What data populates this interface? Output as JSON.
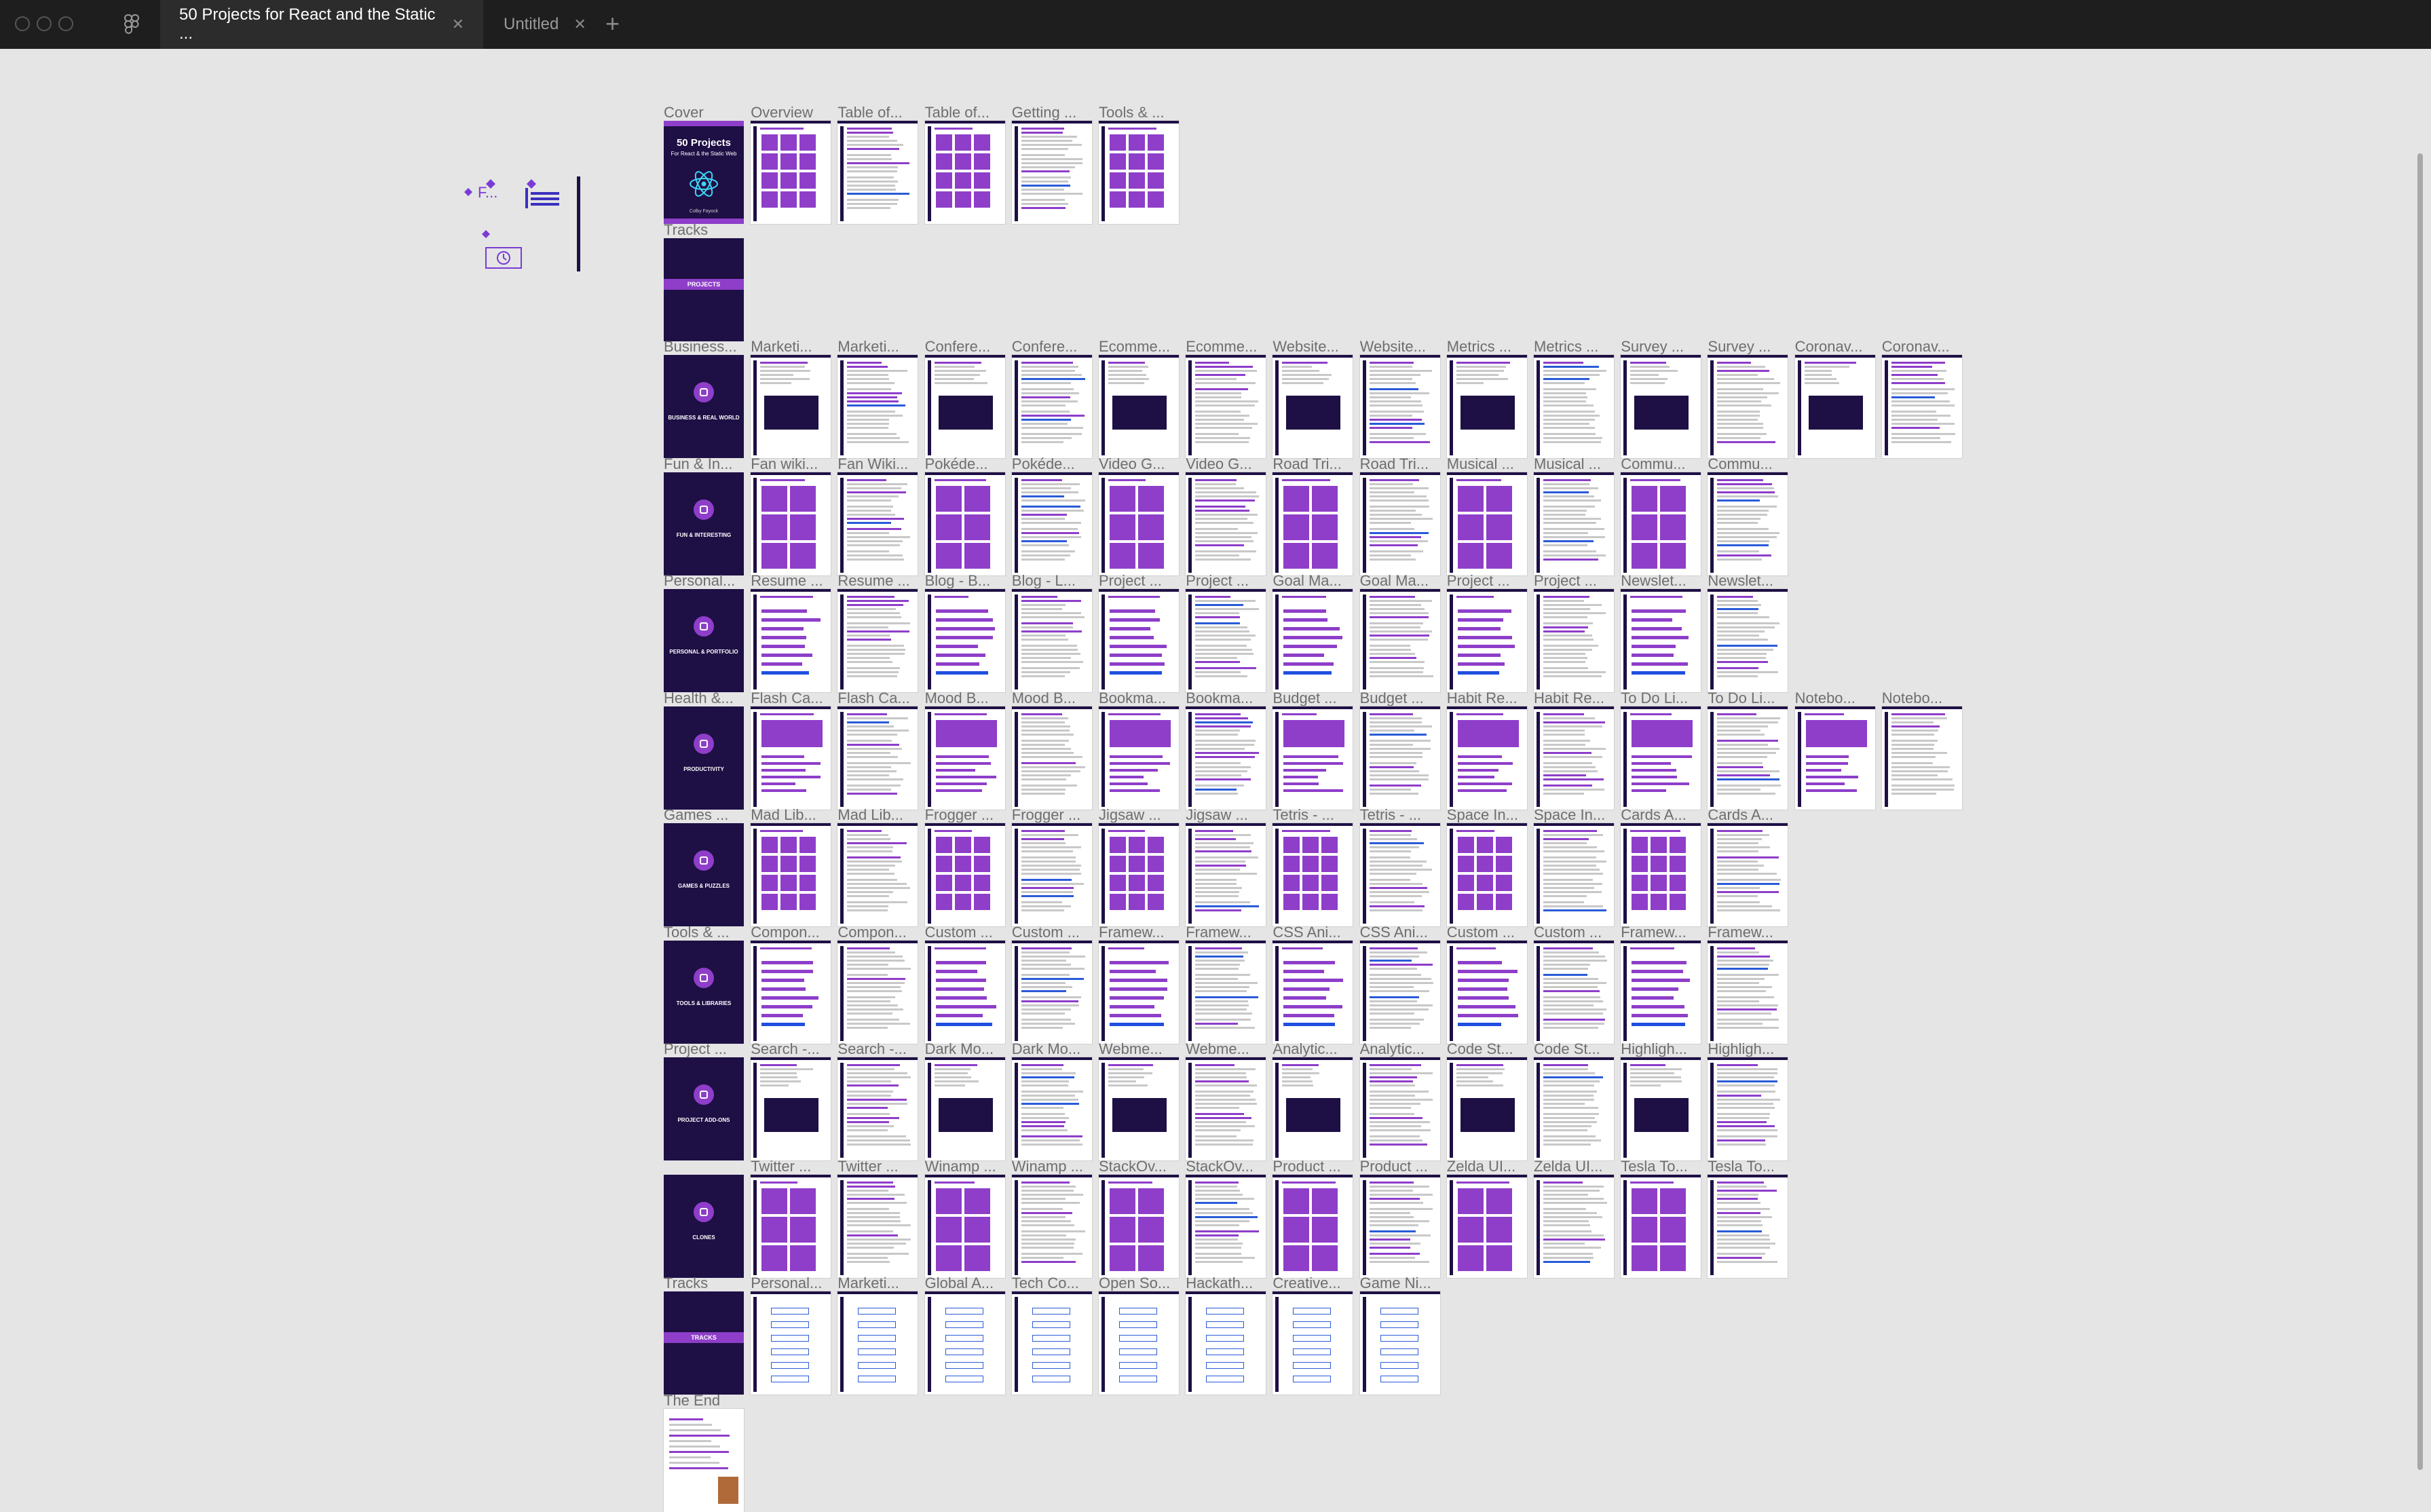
{
  "window": {
    "tabs": [
      {
        "label": "50 Projects for React and the Static ...",
        "active": true
      },
      {
        "label": "Untitled",
        "active": false
      }
    ]
  },
  "canvas": {
    "rows": [
      {
        "labels": [
          "Cover",
          "Overview",
          "Table of...",
          "Table of...",
          "Getting ...",
          "Tools & ..."
        ]
      },
      {
        "labels": [
          "Tracks"
        ]
      },
      {
        "labels": [
          "Business...",
          "Marketi...",
          "Marketi...",
          "Confere...",
          "Confere...",
          "Ecomme...",
          "Ecomme...",
          "Website...",
          "Website...",
          "Metrics ...",
          "Metrics ...",
          "Survey ...",
          "Survey ...",
          "Coronav...",
          "Coronav..."
        ]
      },
      {
        "labels": [
          "Fun & In...",
          "Fan wiki...",
          "Fan Wiki...",
          "Pokéde...",
          "Pokéde...",
          "Video G...",
          "Video G...",
          "Road Tri...",
          "Road Tri...",
          "Musical ...",
          "Musical ...",
          "Commu...",
          "Commu..."
        ]
      },
      {
        "labels": [
          "Personal...",
          "Resume ...",
          "Resume ...",
          "Blog - B...",
          "Blog - L...",
          "Project ...",
          "Project ...",
          "Goal Ma...",
          "Goal Ma...",
          "Project ...",
          "Project ...",
          "Newslet...",
          "Newslet..."
        ]
      },
      {
        "labels": [
          "Health &...",
          "Flash Ca...",
          "Flash Ca...",
          "Mood B...",
          "Mood B...",
          "Bookma...",
          "Bookma...",
          "Budget ...",
          "Budget ...",
          "Habit Re...",
          "Habit Re...",
          "To Do Li...",
          "To Do Li...",
          "Notebo...",
          "Notebo..."
        ]
      },
      {
        "labels": [
          "Games ...",
          "Mad Lib...",
          "Mad Lib...",
          "Frogger ...",
          "Frogger ...",
          "Jigsaw ...",
          "Jigsaw ...",
          "Tetris - ...",
          "Tetris - ...",
          "Space In...",
          "Space In...",
          "Cards A...",
          "Cards A..."
        ]
      },
      {
        "labels": [
          "Tools & ...",
          "Compon...",
          "Compon...",
          "Custom ...",
          "Custom ...",
          "Framew...",
          "Framew...",
          "CSS Ani...",
          "CSS Ani...",
          "Custom ...",
          "Custom ...",
          "Framew...",
          "Framew..."
        ]
      },
      {
        "labels": [
          "Project ...",
          "Search -...",
          "Search -...",
          "Dark Mo...",
          "Dark Mo...",
          "Webme...",
          "Webme...",
          "Analytic...",
          "Analytic...",
          "Code St...",
          "Code St...",
          "Highligh...",
          "Highligh..."
        ]
      },
      {
        "labels": [
          "",
          "Twitter ...",
          "Twitter ...",
          "Winamp ...",
          "Winamp ...",
          "StackOv...",
          "StackOv...",
          "Product ...",
          "Product ...",
          "Zelda UI...",
          "Zelda UI...",
          "Tesla To...",
          "Tesla To..."
        ]
      },
      {
        "labels": [
          "Tracks",
          "Personal...",
          "Marketi...",
          "Global A...",
          "Tech Co...",
          "Open So...",
          "Hackath...",
          "Creative...",
          "Game Ni..."
        ]
      },
      {
        "labels": [
          "The End"
        ]
      }
    ],
    "cover": {
      "title": "50 Projects",
      "subtitle": "For React & the Static Web",
      "author": "Colby Fayock"
    },
    "sections": [
      {
        "text": "PROJECTS",
        "style": "band"
      },
      {
        "text": "BUSINESS & REAL WORLD",
        "style": "icon"
      },
      {
        "text": "FUN & INTERESTING",
        "style": "icon"
      },
      {
        "text": "PERSONAL & PORTFOLIO",
        "style": "icon"
      },
      {
        "text": "PRODUCTIVITY",
        "style": "icon"
      },
      {
        "text": "GAMES & PUZZLES",
        "style": "icon"
      },
      {
        "text": "TOOLS & LIBRARIES",
        "style": "icon"
      },
      {
        "text": "PROJECT ADD-ONS",
        "style": "icon"
      },
      {
        "text": "CLONES",
        "style": "icon"
      },
      {
        "text": "TRACKS",
        "style": "band"
      }
    ],
    "floating_label": "F..."
  },
  "colors": {
    "titlebar": "#1e1e1e",
    "canvas": "#e5e5e5",
    "brand_dark": "#1e0f45",
    "brand_purple": "#8e3ec9",
    "accent_blue": "#1f4fe0"
  }
}
